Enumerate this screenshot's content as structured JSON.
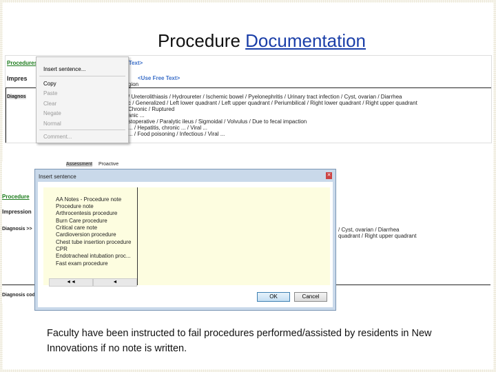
{
  "slide": {
    "title_plain": "Procedure ",
    "title_link": "Documentation",
    "caption": "Faculty have been instructed to fail procedures performed/assisted by residents in New Innovations if no note is written."
  },
  "shot1": {
    "procedure_label": "Procedures",
    "use_free_text_1": "<Use Free Text>",
    "impression_label": "Impres",
    "use_free_text_2": "<Use Free Text>",
    "impression_sub": "gion",
    "diagnosis_label": "Diagnos",
    "lines": [
      "/ Ureterolithiasis / Hydroureter / Ischemic bowel / Pyelonephritis / Urinary tract infection / Cyst, ovarian / Diarrhea",
      "c / Generalized / Left lower quadrant / Left upper quadrant / Periumbilical / Right lower quadrant / Right upper quadrant",
      "Chronic / Ruptured",
      "anic ...",
      "stoperative / Paralytic ileus / Sigmoidal / Volvulus / Due to fecal impaction",
      "... / Hepatitis, chronic ... / Viral ...",
      "... / Food poisoning / Infectious / Viral ..."
    ],
    "context_menu": {
      "items": [
        {
          "label": "Insert sentence...",
          "disabled": false
        },
        {
          "label": "Copy",
          "disabled": false
        },
        {
          "label": "Paste",
          "disabled": true
        },
        {
          "label": "Clear",
          "disabled": true
        },
        {
          "label": "Negate",
          "disabled": true
        },
        {
          "label": "Normal",
          "disabled": true
        },
        {
          "label": "Comment...",
          "disabled": true
        }
      ]
    }
  },
  "shot2": {
    "assessment_label": "Assessment",
    "assessment_value": "Proactive",
    "procedure_label": "Procedure",
    "impression_label": "Impression",
    "diagnosis_label": "Diagnosis >>",
    "right_line_1": "/ Cyst, ovarian / Diarrhea",
    "right_line_2": "quadrant / Right upper quadrant",
    "diagnosis_code_label": "Diagnosis cod"
  },
  "dialog": {
    "title": "Insert sentence",
    "items": [
      "AA Notes - Procedure note",
      "Procedure note",
      "Arthrocentesis procedure",
      "Burn Care procedure",
      "Critical care note",
      "Cardioversion procedure",
      "Chest tube insertion procedure",
      "CPR",
      "Endotracheal intubation proc...",
      "Fast exam procedure"
    ],
    "nav_prev": "◄◄",
    "nav_back": "◄",
    "ok_label": "OK",
    "cancel_label": "Cancel"
  }
}
